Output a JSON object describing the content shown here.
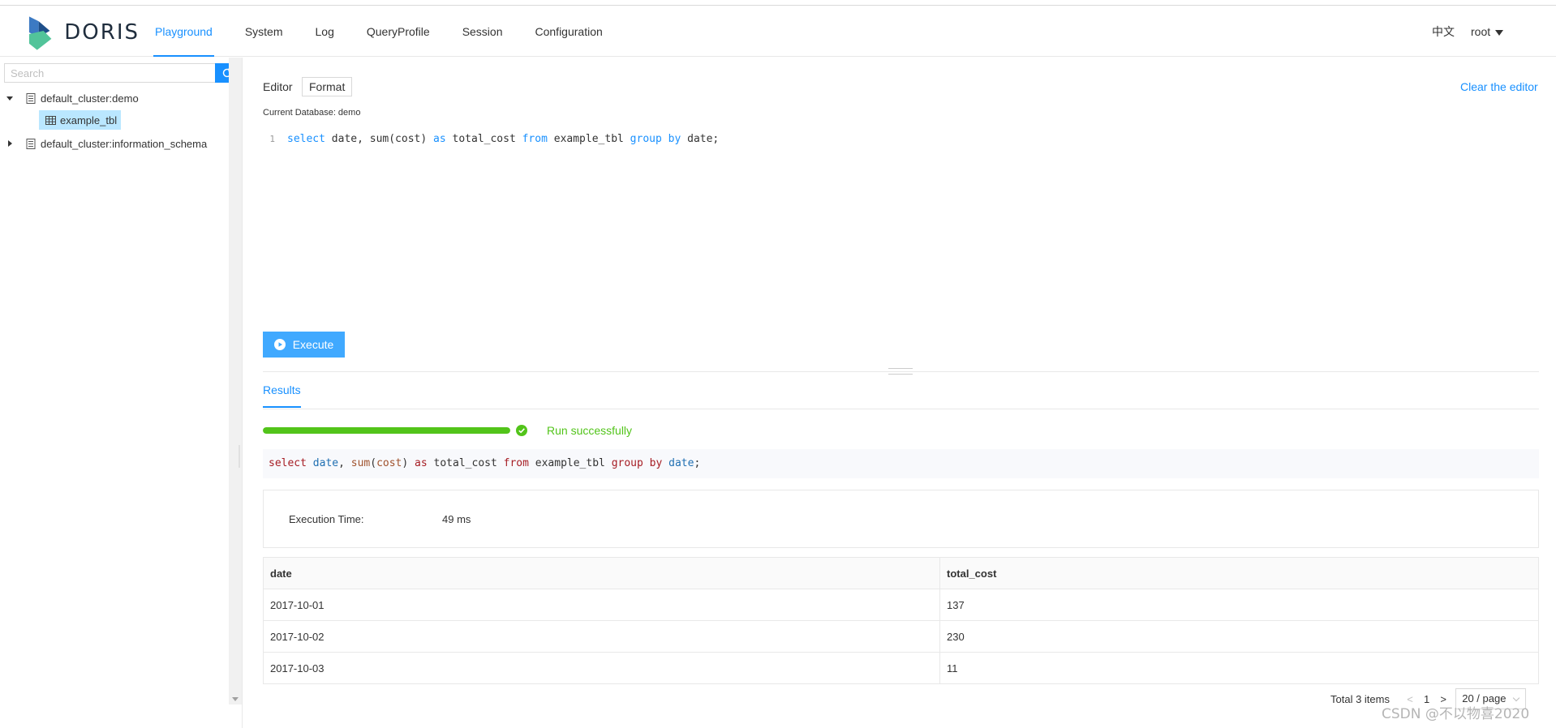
{
  "brand": {
    "name": "DORIS"
  },
  "nav": {
    "items": [
      {
        "label": "Playground",
        "active": true
      },
      {
        "label": "System"
      },
      {
        "label": "Log"
      },
      {
        "label": "QueryProfile"
      },
      {
        "label": "Session"
      },
      {
        "label": "Configuration"
      }
    ],
    "language": "中文",
    "user": "root"
  },
  "sidebar": {
    "search_placeholder": "Search",
    "tree": [
      {
        "label": "default_cluster:demo",
        "expanded": true,
        "children": [
          {
            "label": "example_tbl",
            "selected": true
          }
        ]
      },
      {
        "label": "default_cluster:information_schema",
        "expanded": false
      }
    ]
  },
  "editor": {
    "label": "Editor",
    "format_label": "Format",
    "clear_label": "Clear the editor",
    "current_db": "Current Database: demo",
    "line_number": "1",
    "code_tokens": [
      "select",
      " date, sum(cost) ",
      "as",
      " total_cost ",
      "from",
      " example_tbl ",
      "group",
      " ",
      "by",
      " date;"
    ],
    "execute_label": "Execute"
  },
  "results": {
    "tab_label": "Results",
    "progress_percent": 100,
    "status": "Run successfully",
    "sql_tokens": [
      "select",
      " ",
      "date",
      ", ",
      "sum",
      "(",
      "cost",
      ") ",
      "as",
      " total_cost ",
      "from",
      " example_tbl ",
      "group",
      " ",
      "by",
      " ",
      "date",
      ";"
    ],
    "execution_time_label": "Execution Time:",
    "execution_time_value": "49 ms",
    "table": {
      "columns": [
        "date",
        "total_cost"
      ],
      "rows": [
        [
          "2017-10-01",
          "137"
        ],
        [
          "2017-10-02",
          "230"
        ],
        [
          "2017-10-03",
          "11"
        ]
      ]
    },
    "pagination": {
      "total": "Total 3 items",
      "prev": "<",
      "current_page": "1",
      "next": ">",
      "page_size": "20 / page"
    }
  },
  "watermark": "CSDN @不以物喜2020",
  "colors": {
    "primary": "#1890ff",
    "success": "#52c41a",
    "selected_bg": "#bae7ff"
  }
}
